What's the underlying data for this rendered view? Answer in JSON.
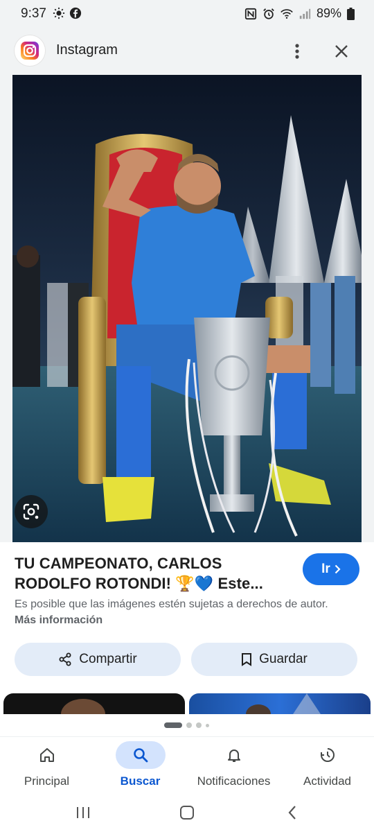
{
  "status_bar": {
    "time": "9:37",
    "battery": "89%",
    "left_icons": [
      "brightness-icon",
      "facebook-icon"
    ],
    "right_icons": [
      "nfc-icon",
      "alarm-icon",
      "wifi-icon",
      "signal-icon",
      "battery-icon"
    ]
  },
  "app_bar": {
    "title": "Instagram",
    "icons": [
      "instagram-logo-icon",
      "more-vert-icon",
      "close-icon"
    ]
  },
  "result": {
    "title_line1": "TU CAMPEONATO, CARLOS",
    "title_line2": "RODOLFO ROTONDI! 🏆💙 Este...",
    "visit_label": "Ir",
    "copyright_text": "Es posible que las imágenes estén sujetas a derechos de autor.",
    "more_info_label": "Más información"
  },
  "actions": {
    "share_label": "Compartir",
    "save_label": "Guardar"
  },
  "pagination": {
    "pages": 4,
    "current": 1
  },
  "bottom_nav": {
    "items": [
      {
        "label": "Principal",
        "icon": "home-icon"
      },
      {
        "label": "Buscar",
        "icon": "search-icon",
        "active": true
      },
      {
        "label": "Notificaciones",
        "icon": "bell-icon"
      },
      {
        "label": "Actividad",
        "icon": "activity-icon"
      }
    ]
  },
  "colors": {
    "accent": "#1a73e8",
    "chip_bg": "#e3ecf8",
    "active_nav": "#0b57d0",
    "surface": "#f1f3f4"
  }
}
